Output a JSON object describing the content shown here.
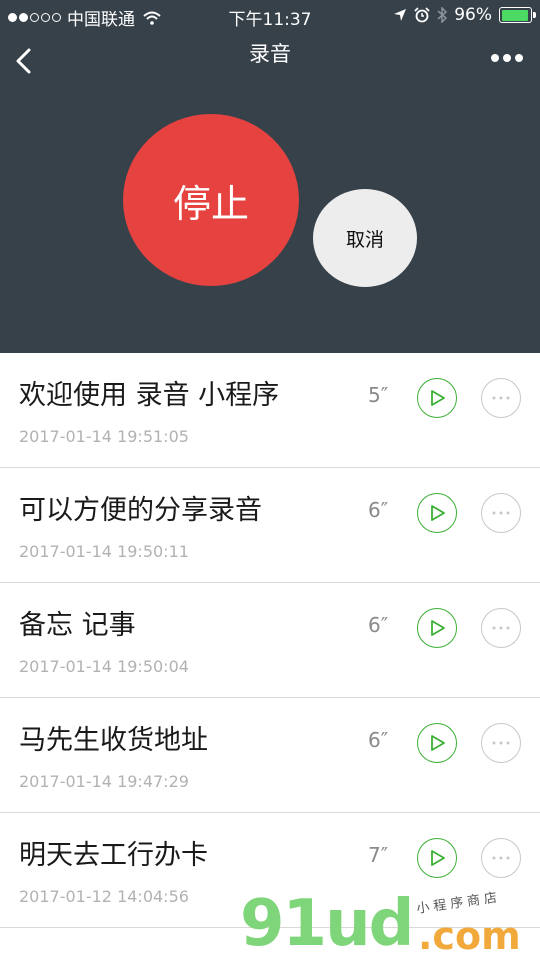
{
  "status_bar": {
    "carrier": "中国联通",
    "time": "下午11:37",
    "battery": "96%",
    "battery_level": 0.96
  },
  "nav": {
    "title": "录音"
  },
  "recorder": {
    "stop_label": "停止",
    "cancel_label": "取消"
  },
  "records": [
    {
      "title": "欢迎使用 录音 小程序",
      "time": "2017-01-14 19:51:05",
      "duration": "5″"
    },
    {
      "title": "可以方便的分享录音",
      "time": "2017-01-14 19:50:11",
      "duration": "6″"
    },
    {
      "title": "备忘 记事",
      "time": "2017-01-14 19:50:04",
      "duration": "6″"
    },
    {
      "title": "马先生收货地址",
      "time": "2017-01-14 19:47:29",
      "duration": "6″"
    },
    {
      "title": "明天去工行办卡",
      "time": "2017-01-12 14:04:56",
      "duration": "7″"
    }
  ],
  "watermark": {
    "main": "91ud",
    "domain": ".com",
    "tagline": "小程序商店"
  },
  "colors": {
    "header_bg": "#37414a",
    "stop_red": "#e64340",
    "play_green": "#3cb035"
  }
}
